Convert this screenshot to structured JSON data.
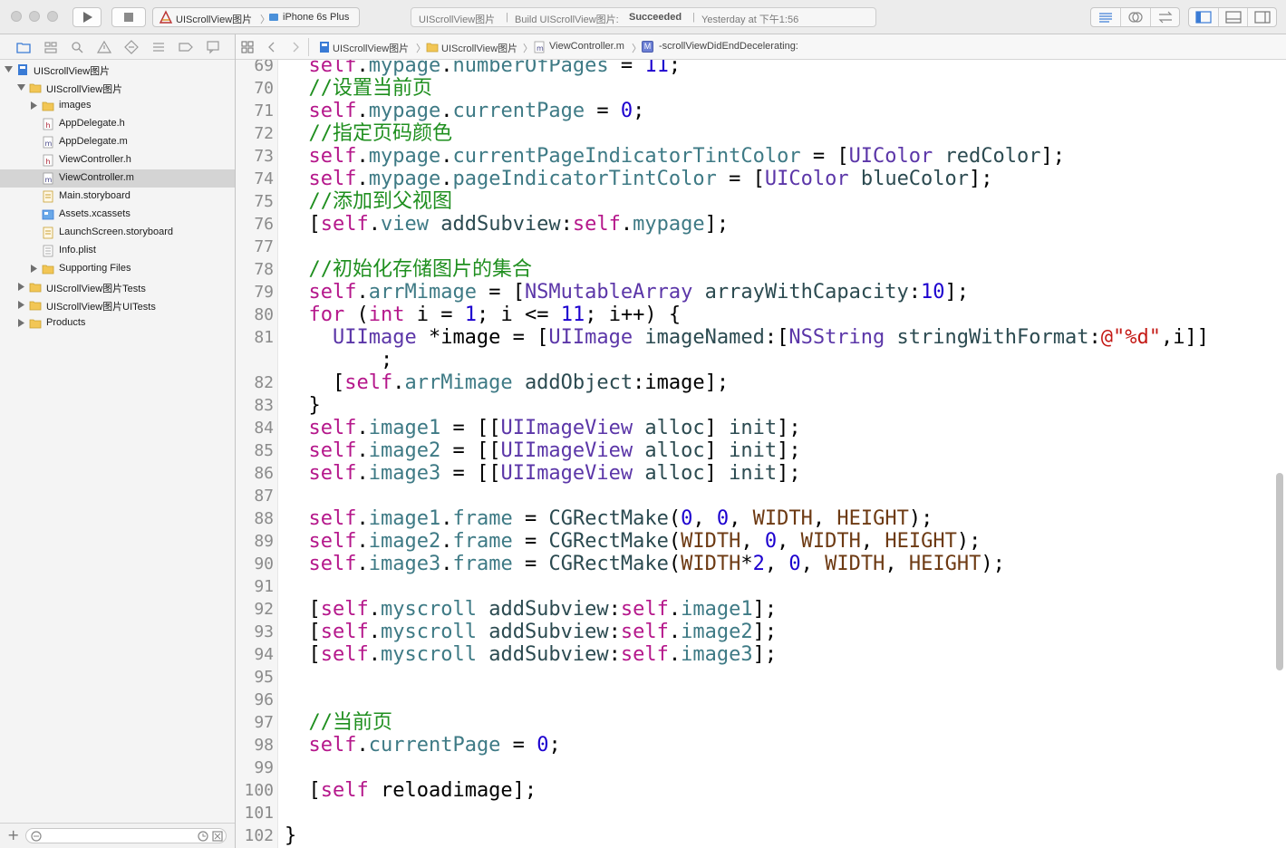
{
  "toolbar": {
    "scheme": "UIScrollView图片",
    "device": "iPhone 6s Plus",
    "activity": {
      "project": "UIScrollView图片",
      "build_prefix": "Build UIScrollView图片:",
      "build_status": "Succeeded",
      "time": "Yesterday at 下午1:56"
    }
  },
  "navigator": {
    "items": [
      {
        "label": "UIScrollView图片",
        "icon": "project-icon",
        "disclosure": "open"
      },
      {
        "label": "UIScrollView图片",
        "icon": "folder-icon",
        "disclosure": "open"
      },
      {
        "label": "images",
        "icon": "folder-icon",
        "disclosure": "closed"
      },
      {
        "label": "AppDelegate.h",
        "icon": "header-file-icon",
        "disclosure": "none"
      },
      {
        "label": "AppDelegate.m",
        "icon": "implementation-file-icon",
        "disclosure": "none"
      },
      {
        "label": "ViewController.h",
        "icon": "header-file-icon",
        "disclosure": "none"
      },
      {
        "label": "ViewController.m",
        "icon": "implementation-file-icon",
        "disclosure": "none",
        "selected": true
      },
      {
        "label": "Main.storyboard",
        "icon": "storyboard-icon",
        "disclosure": "none"
      },
      {
        "label": "Assets.xcassets",
        "icon": "asset-catalog-icon",
        "disclosure": "none"
      },
      {
        "label": "LaunchScreen.storyboard",
        "icon": "storyboard-icon",
        "disclosure": "none"
      },
      {
        "label": "Info.plist",
        "icon": "plist-icon",
        "disclosure": "none"
      },
      {
        "label": "Supporting Files",
        "icon": "folder-icon",
        "disclosure": "closed"
      },
      {
        "label": "UIScrollView图片Tests",
        "icon": "folder-icon",
        "disclosure": "closed"
      },
      {
        "label": "UIScrollView图片UITests",
        "icon": "folder-icon",
        "disclosure": "closed"
      },
      {
        "label": "Products",
        "icon": "folder-icon",
        "disclosure": "closed"
      }
    ]
  },
  "jumpbar": {
    "crumbs": [
      "UIScrollView图片",
      "UIScrollView图片",
      "ViewController.m",
      "-scrollViewDidEndDecelerating:"
    ],
    "method_badge": "M"
  },
  "editor": {
    "lines": [
      {
        "num": "69",
        "tokens": [
          [
            "self",
            "k"
          ],
          [
            ".",
            ""
          ],
          [
            "mypage",
            "p"
          ],
          [
            ".",
            ""
          ],
          [
            "numberOfPages",
            "p"
          ],
          [
            " = ",
            ""
          ],
          [
            "11",
            "n"
          ],
          [
            ";",
            ""
          ]
        ],
        "indent": 2
      },
      {
        "num": "70",
        "tokens": [
          [
            "//设置当前页",
            "c"
          ]
        ],
        "indent": 2
      },
      {
        "num": "71",
        "tokens": [
          [
            "self",
            "k"
          ],
          [
            ".",
            ""
          ],
          [
            "mypage",
            "p"
          ],
          [
            ".",
            ""
          ],
          [
            "currentPage",
            "p"
          ],
          [
            " = ",
            ""
          ],
          [
            "0",
            "n"
          ],
          [
            ";",
            ""
          ]
        ],
        "indent": 2
      },
      {
        "num": "72",
        "tokens": [
          [
            "//指定页码颜色",
            "c"
          ]
        ],
        "indent": 2
      },
      {
        "num": "73",
        "tokens": [
          [
            "self",
            "k"
          ],
          [
            ".",
            ""
          ],
          [
            "mypage",
            "p"
          ],
          [
            ".",
            ""
          ],
          [
            "currentPageIndicatorTintColor",
            "p"
          ],
          [
            " = [",
            ""
          ],
          [
            "UIColor",
            "t2"
          ],
          [
            " ",
            ""
          ],
          [
            "redColor",
            "m"
          ],
          [
            "];",
            ""
          ]
        ],
        "indent": 2
      },
      {
        "num": "74",
        "tokens": [
          [
            "self",
            "k"
          ],
          [
            ".",
            ""
          ],
          [
            "mypage",
            "p"
          ],
          [
            ".",
            ""
          ],
          [
            "pageIndicatorTintColor",
            "p"
          ],
          [
            " = [",
            ""
          ],
          [
            "UIColor",
            "t2"
          ],
          [
            " ",
            ""
          ],
          [
            "blueColor",
            "m"
          ],
          [
            "];",
            ""
          ]
        ],
        "indent": 2
      },
      {
        "num": "75",
        "tokens": [
          [
            "//添加到父视图",
            "c"
          ]
        ],
        "indent": 2
      },
      {
        "num": "76",
        "tokens": [
          [
            "[",
            ""
          ],
          [
            "self",
            "k"
          ],
          [
            ".",
            ""
          ],
          [
            "view",
            "p"
          ],
          [
            " ",
            ""
          ],
          [
            "addSubview",
            "m"
          ],
          [
            ":",
            ""
          ],
          [
            "self",
            "k"
          ],
          [
            ".",
            ""
          ],
          [
            "mypage",
            "p"
          ],
          [
            "];",
            ""
          ]
        ],
        "indent": 2
      },
      {
        "num": "77",
        "tokens": [],
        "indent": 2
      },
      {
        "num": "78",
        "tokens": [
          [
            "//初始化存储图片的集合",
            "c"
          ]
        ],
        "indent": 2
      },
      {
        "num": "79",
        "tokens": [
          [
            "self",
            "k"
          ],
          [
            ".",
            ""
          ],
          [
            "arrMimage",
            "p"
          ],
          [
            " = [",
            ""
          ],
          [
            "NSMutableArray",
            "t2"
          ],
          [
            " ",
            ""
          ],
          [
            "arrayWithCapacity",
            "m"
          ],
          [
            ":",
            ""
          ],
          [
            "10",
            "n"
          ],
          [
            "];",
            ""
          ]
        ],
        "indent": 2
      },
      {
        "num": "80",
        "tokens": [
          [
            "for",
            "k"
          ],
          [
            " (",
            ""
          ],
          [
            "int",
            "k"
          ],
          [
            " i = ",
            ""
          ],
          [
            "1",
            "n"
          ],
          [
            "; i <= ",
            ""
          ],
          [
            "11",
            "n"
          ],
          [
            "; i++) {",
            ""
          ]
        ],
        "indent": 2
      },
      {
        "num": "81",
        "tokens": [
          [
            "UIImage",
            "t2"
          ],
          [
            " *image = [",
            ""
          ],
          [
            "UIImage",
            "t2"
          ],
          [
            " ",
            ""
          ],
          [
            "imageNamed",
            "m"
          ],
          [
            ":[",
            ""
          ],
          [
            "NSString",
            "t2"
          ],
          [
            " ",
            ""
          ],
          [
            "stringWithFormat",
            "m"
          ],
          [
            ":",
            ""
          ],
          [
            "@\"%d\"",
            "s"
          ],
          [
            ",i]]",
            ""
          ]
        ],
        "indent": 4
      },
      {
        "num": "",
        "tokens": [
          [
            ";",
            ""
          ]
        ],
        "indent": 8
      },
      {
        "num": "82",
        "tokens": [
          [
            "[",
            ""
          ],
          [
            "self",
            "k"
          ],
          [
            ".",
            ""
          ],
          [
            "arrMimage",
            "p"
          ],
          [
            " ",
            ""
          ],
          [
            "addObject",
            "m"
          ],
          [
            ":image];",
            ""
          ]
        ],
        "indent": 4
      },
      {
        "num": "83",
        "tokens": [
          [
            "}",
            ""
          ]
        ],
        "indent": 2
      },
      {
        "num": "84",
        "tokens": [
          [
            "self",
            "k"
          ],
          [
            ".",
            ""
          ],
          [
            "image1",
            "p"
          ],
          [
            " = [[",
            ""
          ],
          [
            "UIImageView",
            "t2"
          ],
          [
            " ",
            ""
          ],
          [
            "alloc",
            "m"
          ],
          [
            "] ",
            ""
          ],
          [
            "init",
            "m"
          ],
          [
            "];",
            ""
          ]
        ],
        "indent": 2
      },
      {
        "num": "85",
        "tokens": [
          [
            "self",
            "k"
          ],
          [
            ".",
            ""
          ],
          [
            "image2",
            "p"
          ],
          [
            " = [[",
            ""
          ],
          [
            "UIImageView",
            "t2"
          ],
          [
            " ",
            ""
          ],
          [
            "alloc",
            "m"
          ],
          [
            "] ",
            ""
          ],
          [
            "init",
            "m"
          ],
          [
            "];",
            ""
          ]
        ],
        "indent": 2
      },
      {
        "num": "86",
        "tokens": [
          [
            "self",
            "k"
          ],
          [
            ".",
            ""
          ],
          [
            "image3",
            "p"
          ],
          [
            " = [[",
            ""
          ],
          [
            "UIImageView",
            "t2"
          ],
          [
            " ",
            ""
          ],
          [
            "alloc",
            "m"
          ],
          [
            "] ",
            ""
          ],
          [
            "init",
            "m"
          ],
          [
            "];",
            ""
          ]
        ],
        "indent": 2
      },
      {
        "num": "87",
        "tokens": [],
        "indent": 2
      },
      {
        "num": "88",
        "tokens": [
          [
            "self",
            "k"
          ],
          [
            ".",
            ""
          ],
          [
            "image1",
            "p"
          ],
          [
            ".",
            ""
          ],
          [
            "frame",
            "p"
          ],
          [
            " = ",
            ""
          ],
          [
            "CGRectMake",
            "m"
          ],
          [
            "(",
            ""
          ],
          [
            "0",
            "n"
          ],
          [
            ", ",
            ""
          ],
          [
            "0",
            "n"
          ],
          [
            ", ",
            ""
          ],
          [
            "WIDTH",
            "mc"
          ],
          [
            ", ",
            ""
          ],
          [
            "HEIGHT",
            "mc"
          ],
          [
            ");",
            ""
          ]
        ],
        "indent": 2
      },
      {
        "num": "89",
        "tokens": [
          [
            "self",
            "k"
          ],
          [
            ".",
            ""
          ],
          [
            "image2",
            "p"
          ],
          [
            ".",
            ""
          ],
          [
            "frame",
            "p"
          ],
          [
            " = ",
            ""
          ],
          [
            "CGRectMake",
            "m"
          ],
          [
            "(",
            ""
          ],
          [
            "WIDTH",
            "mc"
          ],
          [
            ", ",
            ""
          ],
          [
            "0",
            "n"
          ],
          [
            ", ",
            ""
          ],
          [
            "WIDTH",
            "mc"
          ],
          [
            ", ",
            ""
          ],
          [
            "HEIGHT",
            "mc"
          ],
          [
            ");",
            ""
          ]
        ],
        "indent": 2
      },
      {
        "num": "90",
        "tokens": [
          [
            "self",
            "k"
          ],
          [
            ".",
            ""
          ],
          [
            "image3",
            "p"
          ],
          [
            ".",
            ""
          ],
          [
            "frame",
            "p"
          ],
          [
            " = ",
            ""
          ],
          [
            "CGRectMake",
            "m"
          ],
          [
            "(",
            ""
          ],
          [
            "WIDTH",
            "mc"
          ],
          [
            "*",
            ""
          ],
          [
            "2",
            "n"
          ],
          [
            ", ",
            ""
          ],
          [
            "0",
            "n"
          ],
          [
            ", ",
            ""
          ],
          [
            "WIDTH",
            "mc"
          ],
          [
            ", ",
            ""
          ],
          [
            "HEIGHT",
            "mc"
          ],
          [
            ");",
            ""
          ]
        ],
        "indent": 2
      },
      {
        "num": "91",
        "tokens": [],
        "indent": 2
      },
      {
        "num": "92",
        "tokens": [
          [
            "[",
            ""
          ],
          [
            "self",
            "k"
          ],
          [
            ".",
            ""
          ],
          [
            "myscroll",
            "p"
          ],
          [
            " ",
            ""
          ],
          [
            "addSubview",
            "m"
          ],
          [
            ":",
            ""
          ],
          [
            "self",
            "k"
          ],
          [
            ".",
            ""
          ],
          [
            "image1",
            "p"
          ],
          [
            "];",
            ""
          ]
        ],
        "indent": 2
      },
      {
        "num": "93",
        "tokens": [
          [
            "[",
            ""
          ],
          [
            "self",
            "k"
          ],
          [
            ".",
            ""
          ],
          [
            "myscroll",
            "p"
          ],
          [
            " ",
            ""
          ],
          [
            "addSubview",
            "m"
          ],
          [
            ":",
            ""
          ],
          [
            "self",
            "k"
          ],
          [
            ".",
            ""
          ],
          [
            "image2",
            "p"
          ],
          [
            "];",
            ""
          ]
        ],
        "indent": 2
      },
      {
        "num": "94",
        "tokens": [
          [
            "[",
            ""
          ],
          [
            "self",
            "k"
          ],
          [
            ".",
            ""
          ],
          [
            "myscroll",
            "p"
          ],
          [
            " ",
            ""
          ],
          [
            "addSubview",
            "m"
          ],
          [
            ":",
            ""
          ],
          [
            "self",
            "k"
          ],
          [
            ".",
            ""
          ],
          [
            "image3",
            "p"
          ],
          [
            "];",
            ""
          ]
        ],
        "indent": 2
      },
      {
        "num": "95",
        "tokens": [],
        "indent": 2
      },
      {
        "num": "96",
        "tokens": [],
        "indent": 2
      },
      {
        "num": "97",
        "tokens": [
          [
            "//当前页",
            "c"
          ]
        ],
        "indent": 2
      },
      {
        "num": "98",
        "tokens": [
          [
            "self",
            "k"
          ],
          [
            ".",
            ""
          ],
          [
            "currentPage",
            "p"
          ],
          [
            " = ",
            ""
          ],
          [
            "0",
            "n"
          ],
          [
            ";",
            ""
          ]
        ],
        "indent": 2
      },
      {
        "num": "99",
        "tokens": [],
        "indent": 2
      },
      {
        "num": "100",
        "tokens": [
          [
            "[",
            ""
          ],
          [
            "self",
            "k"
          ],
          [
            " reloadimage];",
            ""
          ]
        ],
        "indent": 2
      },
      {
        "num": "101",
        "tokens": [],
        "indent": 2
      },
      {
        "num": "102",
        "tokens": [
          [
            "}",
            ""
          ]
        ],
        "indent": 0
      }
    ]
  },
  "colors": {
    "keyword": "#b5178b",
    "property": "#3e7a85",
    "comment": "#1f8f1f",
    "number": "#1c00cf",
    "class": "#5b36a8",
    "method": "#2b4a50",
    "macro": "#6d3a13",
    "string": "#c41a16",
    "selection": "#d4d4d4"
  }
}
